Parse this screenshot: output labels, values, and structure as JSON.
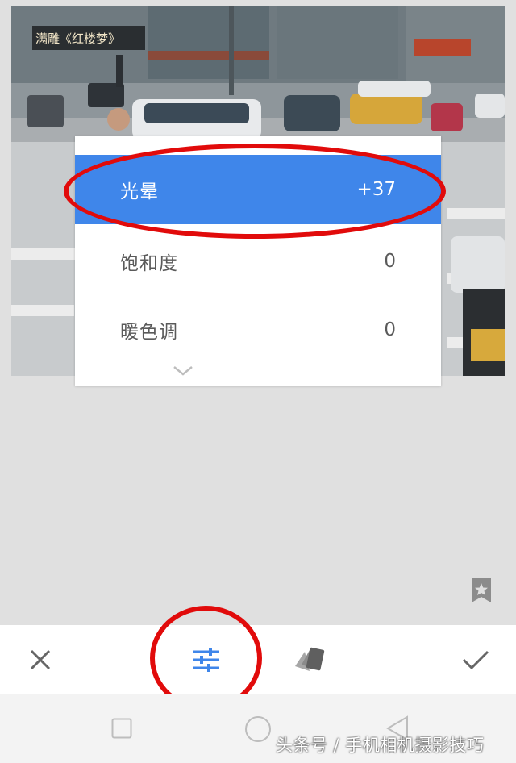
{
  "adjust_menu": {
    "items": [
      {
        "label": "光晕",
        "value": "+37",
        "selected": true
      },
      {
        "label": "饱和度",
        "value": "0",
        "selected": false
      },
      {
        "label": "暖色调",
        "value": "0",
        "selected": false
      }
    ]
  },
  "photo": {
    "sign_text": "满雕《红楼梦》"
  },
  "toolbar": {
    "cancel_icon": "close-icon",
    "tune_icon": "tune-sliders-icon",
    "styles_icon": "styles-cards-icon",
    "apply_icon": "check-icon"
  },
  "navigation": {
    "buttons": [
      "recent-apps",
      "home",
      "back"
    ]
  },
  "watermark": "头条号 / 手机相机摄影技巧",
  "colors": {
    "accent": "#3f86ea",
    "highlight_annotation": "#e10b0b",
    "background": "#e0e0e0"
  }
}
